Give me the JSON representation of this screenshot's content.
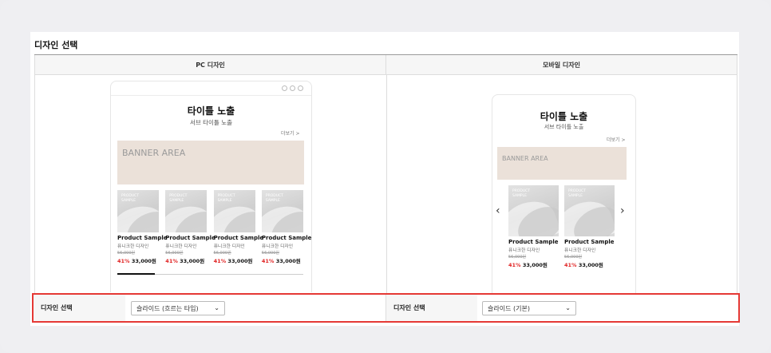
{
  "section_title": "디자인 선택",
  "columns": {
    "pc": "PC 디자인",
    "mobile": "모바일 디자인"
  },
  "preview": {
    "title": "타이틀 노출",
    "subtitle": "서브 타이틀 노출",
    "more": "더보기 >",
    "banner": "BANNER AREA",
    "thumb_placeholder": "PRODUCT SAMPLE",
    "product": {
      "name": "Product Sample",
      "desc": "퓨니크한 디자인",
      "original_price": "56,000원",
      "discount": "41%",
      "price": "33,000원"
    },
    "pc_product_count": 4,
    "mobile_product_count": 2,
    "prev_arrow": "‹",
    "next_arrow": "›"
  },
  "selects": {
    "label": "디자인 선택",
    "pc_value": "슬라이드 (흐르는 타입)",
    "mobile_value": "슬라이드 (기본)"
  },
  "colors": {
    "highlight_border": "#e53935",
    "discount": "#e02020",
    "banner_bg": "#ebe1d9"
  }
}
